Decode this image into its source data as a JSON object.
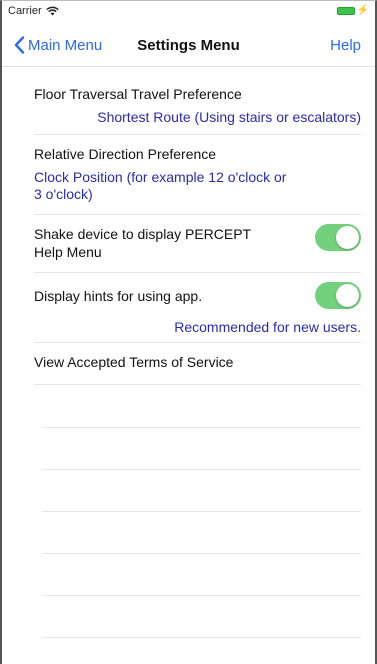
{
  "status_bar": {
    "carrier": "Carrier"
  },
  "nav": {
    "back_label": "Main Menu",
    "title": "Settings Menu",
    "help_label": "Help"
  },
  "settings": {
    "floor_traversal": {
      "label": "Floor Traversal Travel Preference",
      "value": "Shortest Route (Using stairs or escalators)"
    },
    "relative_direction": {
      "label": "Relative Direction Preference",
      "value_line1": "Clock Position  (for example 12 o'clock or",
      "value_line2": "3 o'clock)"
    },
    "shake_device": {
      "label_line1": "Shake device to display PERCEPT",
      "label_line2": "Help Menu",
      "enabled": true
    },
    "display_hints": {
      "label": "Display hints for using app.",
      "note": "Recommended for new users.",
      "enabled": true
    },
    "terms": {
      "label": "View Accepted Terms of Service"
    }
  },
  "colors": {
    "accent_blue": "#2f6bd9",
    "value_blue": "#2b2baa",
    "toggle_on": "#73d07c",
    "battery": "#3cc34a"
  }
}
